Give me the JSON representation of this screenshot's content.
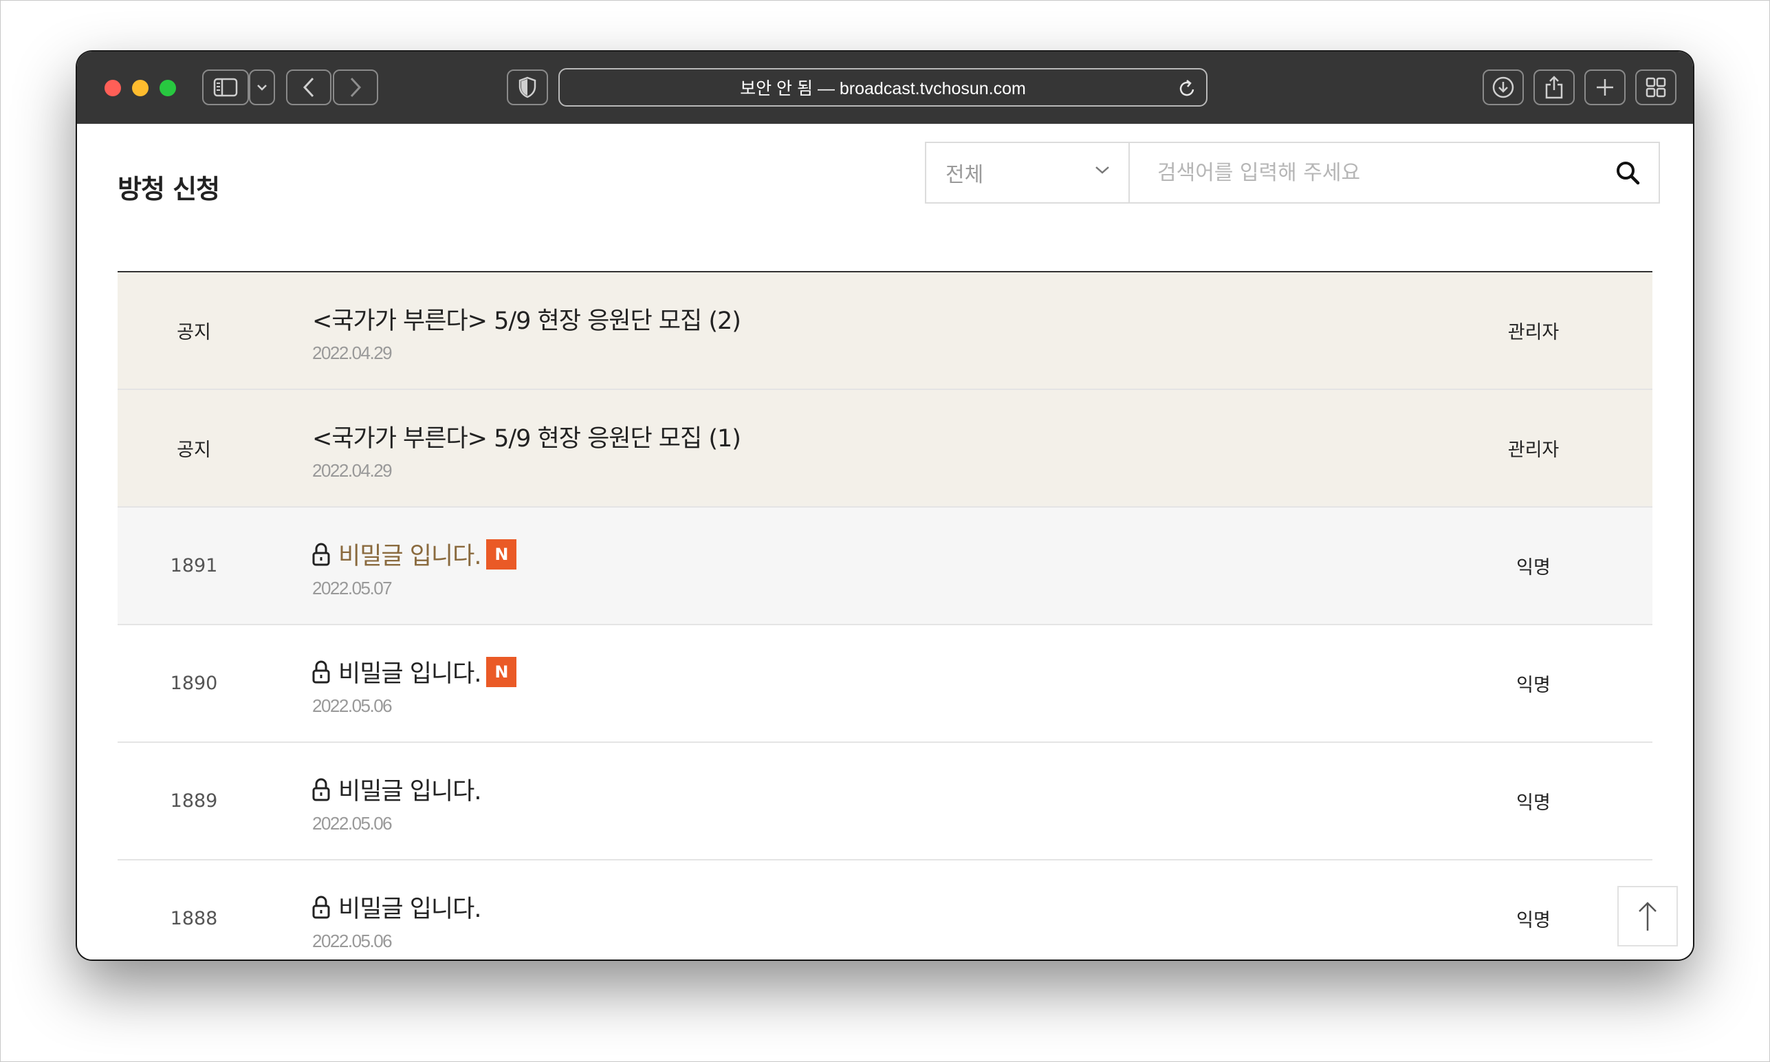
{
  "browser": {
    "url_text": "보안 안 됨 — broadcast.tvchosun.com",
    "icons": {
      "sidebar": "sidebar-icon",
      "back": "chevron-left-icon",
      "forward": "chevron-right-icon",
      "privacy": "shield-icon",
      "reload": "reload-icon",
      "download": "download-icon",
      "share": "share-icon",
      "new_tab": "plus-icon",
      "tab_overview": "grid-icon"
    }
  },
  "page": {
    "title": "방청 신청"
  },
  "search": {
    "category_selected": "전체",
    "placeholder": "검색어를 입력해 주세요"
  },
  "posts": [
    {
      "num": "공지",
      "title": "<국가가 부른다> 5/9 현장 응원단 모집 (2)",
      "date": "2022.04.29",
      "author": "관리자",
      "notice": true
    },
    {
      "num": "공지",
      "title": "<국가가 부른다> 5/9 현장 응원단 모집 (1)",
      "date": "2022.04.29",
      "author": "관리자",
      "notice": true
    },
    {
      "num": "1891",
      "title": "비밀글 입니다.",
      "date": "2022.05.07",
      "author": "익명",
      "locked": true,
      "new_badge": "N"
    },
    {
      "num": "1890",
      "title": "비밀글 입니다.",
      "date": "2022.05.06",
      "author": "익명",
      "locked": true,
      "new_badge": "N"
    },
    {
      "num": "1889",
      "title": "비밀글 입니다.",
      "date": "2022.05.06",
      "author": "익명",
      "locked": true
    },
    {
      "num": "1888",
      "title": "비밀글 입니다.",
      "date": "2022.05.06",
      "author": "익명",
      "locked": true
    }
  ],
  "colors": {
    "toolbar": "#363636",
    "notice_row": "#f3f0e9",
    "new_badge": "#ea5a26",
    "active_title": "#8a6a3e"
  }
}
